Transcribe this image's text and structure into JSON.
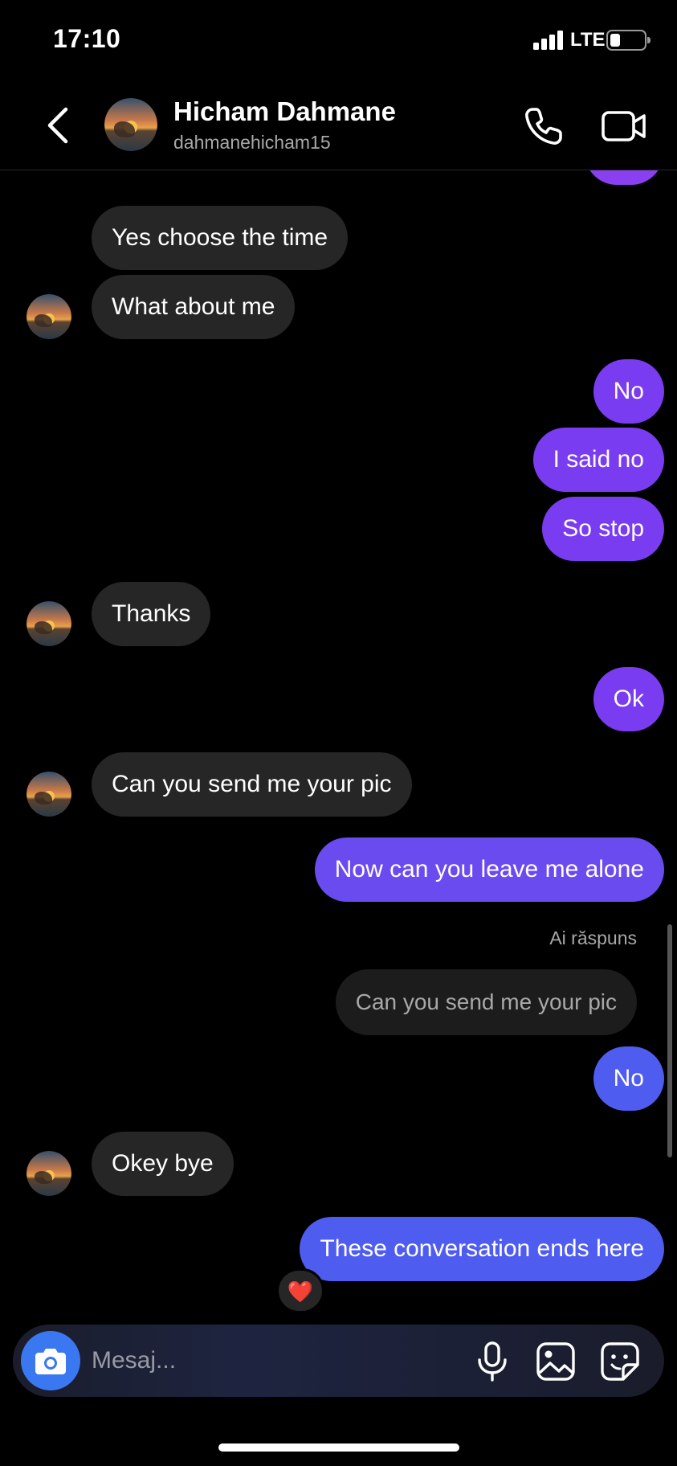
{
  "status_bar": {
    "time": "17:10",
    "network": "LTE"
  },
  "header": {
    "name": "Hicham Dahmane",
    "username": "dahmanehicham15",
    "back_icon": "chevron-left-icon",
    "call_icon": "phone-icon",
    "video_icon": "video-camera-icon"
  },
  "messages": [
    {
      "from": "them",
      "text": "Yes choose the time"
    },
    {
      "from": "them",
      "text": "What about me"
    },
    {
      "from": "me",
      "text": "No"
    },
    {
      "from": "me",
      "text": "I said no"
    },
    {
      "from": "me",
      "text": "So stop"
    },
    {
      "from": "them",
      "text": "Thanks"
    },
    {
      "from": "me",
      "text": "Ok"
    },
    {
      "from": "them",
      "text": "Can you send me your pic"
    },
    {
      "from": "me",
      "text": "Now can you leave me alone"
    },
    {
      "from": "me",
      "text": "No"
    },
    {
      "from": "them",
      "text": "Okey bye"
    },
    {
      "from": "me",
      "text": "These conversation ends here"
    }
  ],
  "reply": {
    "label": "Ai răspuns",
    "quoted_text": "Can you send me your pic"
  },
  "reaction": {
    "emoji": "❤️"
  },
  "composer": {
    "placeholder": "Mesaj...",
    "icons": [
      "camera-icon",
      "microphone-icon",
      "gallery-icon",
      "sticker-icon"
    ]
  },
  "colors": {
    "background": "#000000",
    "incoming_bubble": "#262626",
    "outgoing_purple": "#7a3cf0",
    "outgoing_violet": "#6a4bf0",
    "outgoing_blue": "#4f5cf0",
    "camera_button": "#3a78f2"
  }
}
